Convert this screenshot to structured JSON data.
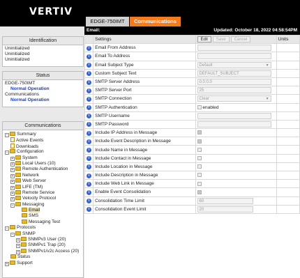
{
  "brand": "VERTIV",
  "tabs": [
    {
      "label": "EDGE-750IMT"
    },
    {
      "label": "Communications"
    }
  ],
  "header": {
    "left": "Email:",
    "right": "Updated: October 18, 2022 04:58:54PM"
  },
  "identification": {
    "title": "Identification",
    "lines": [
      "Uninitialized",
      "Uninitialized",
      "Uninitialized"
    ]
  },
  "status": {
    "title": "Status",
    "device": "EDGE-750IMT",
    "device_state": "Normal Operation",
    "comm": "Communications",
    "comm_state": "Normal Operation"
  },
  "communications": {
    "title": "Communications",
    "tree": [
      "Summary",
      "Active Events",
      "Downloads",
      "Configuration",
      "System",
      "Local Users (10)",
      "Remote Authentication",
      "Network",
      "Web Server",
      "LIFE (TM)",
      "Remote Service",
      "Velocity Protocol",
      "Messaging",
      "Email",
      "SMS",
      "Messaging Test",
      "Protocols",
      "SNMP",
      "SNMPv3 User (20)",
      "SNMPv1 Trap (20)",
      "SNMPv1/v2c Access (20)",
      "Status",
      "Support"
    ]
  },
  "settings": {
    "header": "Settings",
    "units_header": "Units",
    "buttons": {
      "edit": "Edit",
      "save": "Save",
      "cancel": "Cancel"
    },
    "rows": [
      {
        "label": "Email From Address",
        "value": ""
      },
      {
        "label": "Email To Address",
        "value": ""
      },
      {
        "label": "Email Subject Type",
        "value": "Default"
      },
      {
        "label": "Custom Subject Text",
        "value": "DEFAULT_SUBJECT"
      },
      {
        "label": "SMTP Server Address",
        "value": "0.0.0.0"
      },
      {
        "label": "SMTP Server Port",
        "value": "25"
      },
      {
        "label": "SMTP Connection",
        "value": "Clear"
      },
      {
        "label": "SMTP Authentication",
        "value": "enabled"
      },
      {
        "label": "SMTP Username",
        "value": ""
      },
      {
        "label": "SMTP Password",
        "value": ""
      },
      {
        "label": "Include IP Address in Message",
        "value": ""
      },
      {
        "label": "Include Event Description in Message",
        "value": ""
      },
      {
        "label": "Include Name in Message",
        "value": ""
      },
      {
        "label": "Include Contact in Message",
        "value": ""
      },
      {
        "label": "Include Location in Message",
        "value": ""
      },
      {
        "label": "Include Description in Message",
        "value": ""
      },
      {
        "label": "Include Web Link in Message",
        "value": ""
      },
      {
        "label": "Enable Event Consolidation",
        "value": ""
      },
      {
        "label": "Consolidation Time Limit",
        "value": "60"
      },
      {
        "label": "Consolidation Event Limit",
        "value": "20"
      }
    ]
  },
  "icons": {
    "info": "info-icon",
    "folder": "folder-icon",
    "page": "page-icon",
    "expander": "expand-icon"
  }
}
